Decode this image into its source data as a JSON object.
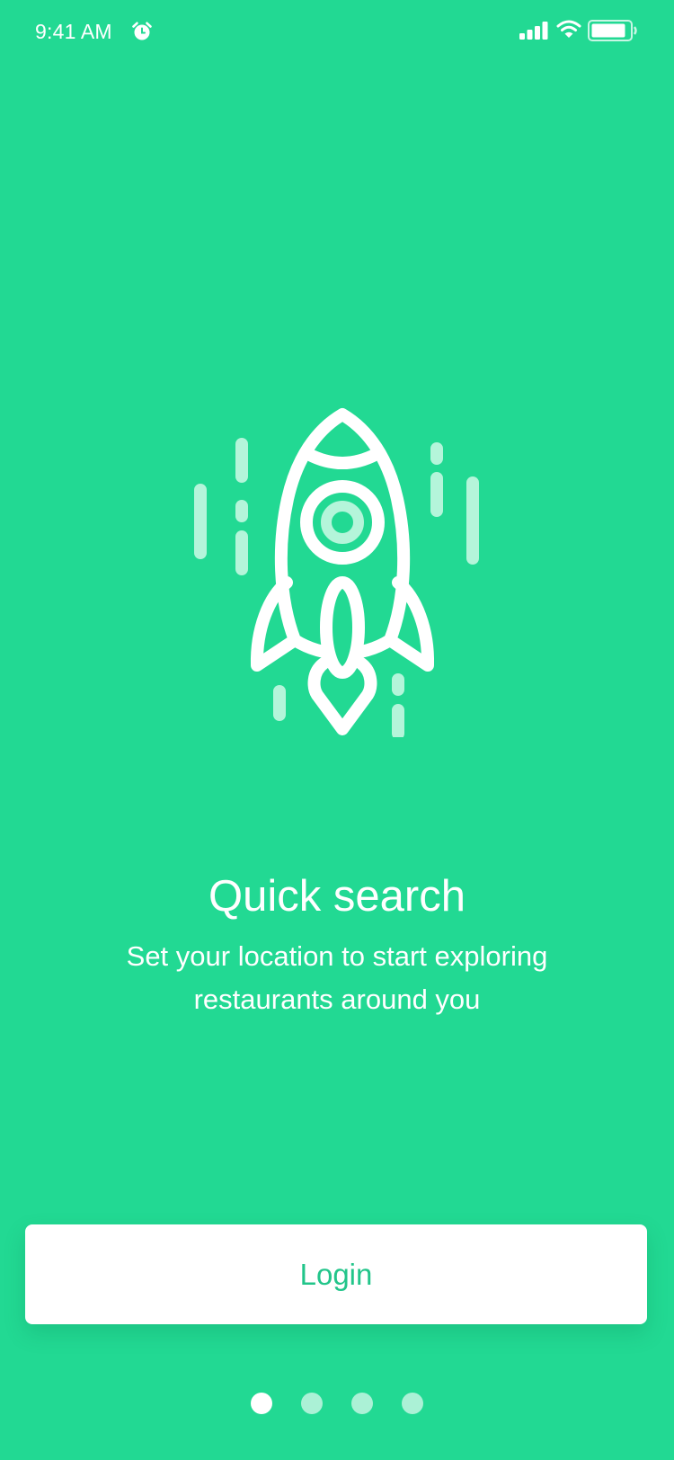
{
  "status_bar": {
    "time": "9:41 AM",
    "icons": [
      "alarm-icon",
      "cellular-signal-icon",
      "wifi-icon",
      "battery-icon"
    ]
  },
  "onboarding": {
    "illustration": "rocket-icon",
    "title": "Quick search",
    "subtitle": "Set your location to start exploring restaurants around you",
    "login_label": "Login",
    "pages_total": 4,
    "active_page": 1
  },
  "colors": {
    "background": "#22D993",
    "button_background": "#FFFFFF",
    "button_text": "#22C58A",
    "text": "#FFFFFF",
    "accent_light": "#B4F5DA"
  }
}
